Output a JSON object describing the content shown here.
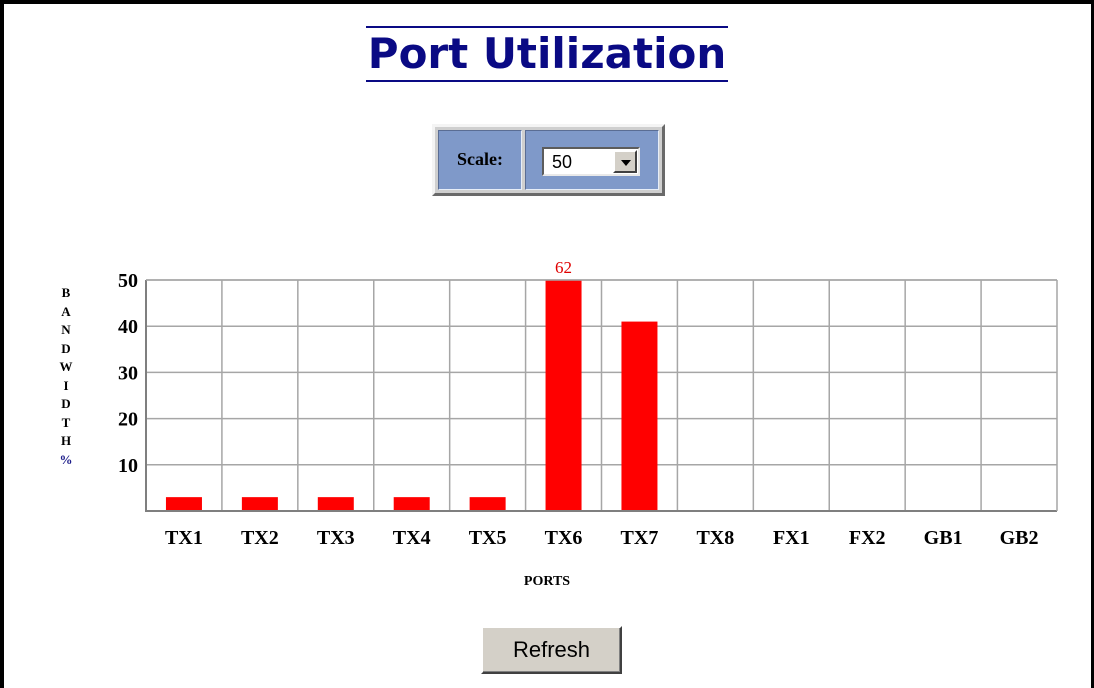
{
  "page": {
    "title": "Port Utilization"
  },
  "scale": {
    "label": "Scale:",
    "selected": "50"
  },
  "refresh_label": "Refresh",
  "colors": {
    "title": "#0a0a84",
    "scale_panel": "#7f99c9",
    "bar": "#ff0000",
    "bar_label": "#e00000"
  },
  "chart_data": {
    "type": "bar",
    "categories": [
      "TX1",
      "TX2",
      "TX3",
      "TX4",
      "TX5",
      "TX6",
      "TX7",
      "TX8",
      "FX1",
      "FX2",
      "GB1",
      "GB2"
    ],
    "values": [
      3,
      3,
      3,
      3,
      3,
      62,
      41,
      0,
      0,
      0,
      0,
      0
    ],
    "value_labels": [
      "",
      "",
      "",
      "",
      "",
      "62",
      "",
      "",
      "",
      "",
      "",
      ""
    ],
    "ylim": [
      0,
      50
    ],
    "yticks": [
      "10",
      "20",
      "30",
      "40",
      "50"
    ],
    "ylabel": "BANDWIDTH%",
    "xlabel": "PORTS",
    "grid": true
  }
}
